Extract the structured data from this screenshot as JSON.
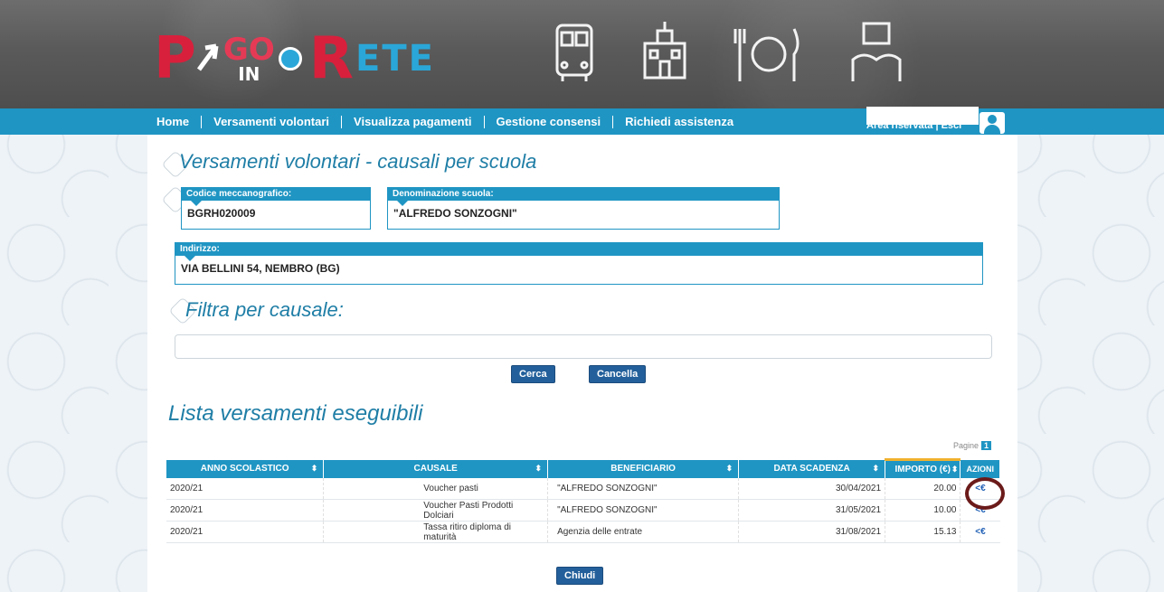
{
  "header": {
    "logo": {
      "p": "P",
      "go": "GO",
      "in": "IN",
      "r": "R",
      "ete": "ETE"
    },
    "icons": [
      "bus-icon",
      "school-icon",
      "cutlery-icon",
      "museum-icon"
    ]
  },
  "nav": {
    "items": [
      "Home",
      "Versamenti volontari",
      "Visualizza pagamenti",
      "Gestione consensi",
      "Richiedi assistenza"
    ],
    "reserved_label": "Area riservata",
    "separator": "|",
    "exit_label": "Esci"
  },
  "page": {
    "title": "Versamenti volontari - causali per scuola",
    "school": {
      "code_label": "Codice meccanografico:",
      "code_value": "BGRH020009",
      "name_label": "Denominazione scuola:",
      "name_value": "\"ALFREDO SONZOGNI\"",
      "address_label": "Indirizzo:",
      "address_value": "VIA BELLINI 54, NEMBRO (BG)"
    },
    "filter_title": "Filtra per causale:",
    "filter_value": "",
    "search_label": "Cerca",
    "clear_label": "Cancella",
    "list_title": "Lista versamenti eseguibili",
    "pages_label": "Pagine",
    "current_page": "1",
    "close_label": "Chiudi"
  },
  "table": {
    "columns": [
      "ANNO SCOLASTICO",
      "CAUSALE",
      "BENEFICIARIO",
      "DATA SCADENZA",
      "IMPORTO (€)",
      "AZIONI"
    ],
    "sort_icon": "⬍",
    "rows": [
      {
        "anno": "2020/21",
        "causale": "Voucher pasti",
        "beneficiario": "\"ALFREDO SONZOGNI\"",
        "scadenza": "30/04/2021",
        "importo": "20.00",
        "azione": "<€"
      },
      {
        "anno": "2020/21",
        "causale": "Voucher Pasti Prodotti Dolciari",
        "beneficiario": "\"ALFREDO SONZOGNI\"",
        "scadenza": "31/05/2021",
        "importo": "10.00",
        "azione": "<€"
      },
      {
        "anno": "2020/21",
        "causale": "Tassa ritiro diploma di maturità",
        "beneficiario": "Agenzia delle entrate",
        "scadenza": "31/08/2021",
        "importo": "15.13",
        "azione": "<€"
      }
    ]
  },
  "colors": {
    "brand_blue": "#1f95c3",
    "button_blue": "#23609b",
    "logo_red": "#d8203c",
    "highlight": "#6b1a1a"
  }
}
